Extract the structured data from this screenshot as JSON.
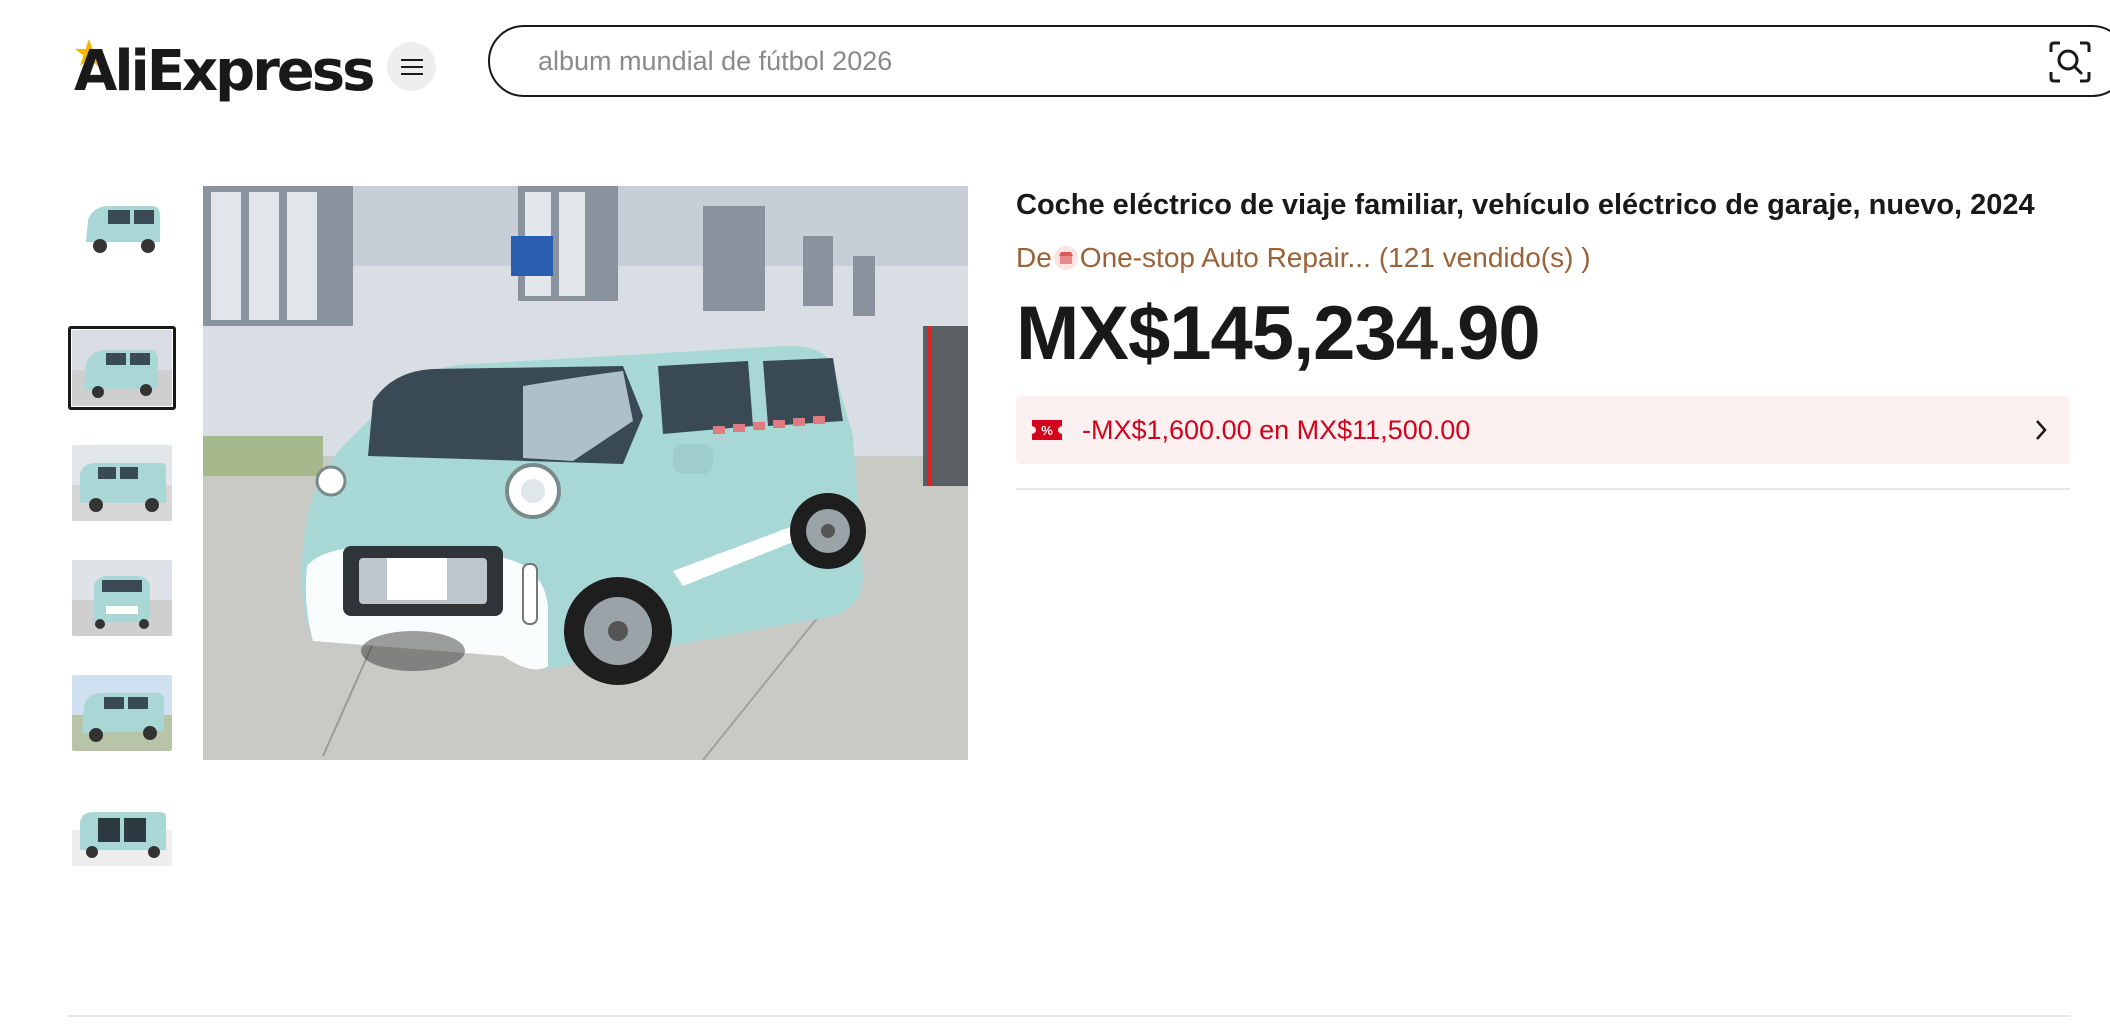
{
  "header": {
    "logo_text": "AliExpress",
    "search": {
      "placeholder": "album mundial de fútbol 2026",
      "value": ""
    },
    "menu_icon": "hamburger-menu-icon",
    "camera_icon": "image-search-icon"
  },
  "gallery": {
    "thumbnails": [
      {
        "label": "van-front-three-quarter",
        "active": false
      },
      {
        "label": "van-front-three-quarter-factory",
        "active": true
      },
      {
        "label": "van-side-view",
        "active": false
      },
      {
        "label": "van-front-view",
        "active": false
      },
      {
        "label": "van-front-side-outdoor",
        "active": false
      },
      {
        "label": "van-doors-open",
        "active": false
      }
    ]
  },
  "product": {
    "title": "Coche eléctrico de viaje familiar, vehículo eléctrico de garaje, nuevo, 2024",
    "store_prefix": "De",
    "store_name": "One-stop Auto Repair...",
    "sold_text": "(121 vendido(s) )",
    "price": "MX$145,234.90",
    "coupon_text": "-MX$1,600.00 en MX$11,500.00",
    "coupon_icon": "percent-coupon-icon"
  },
  "colors": {
    "coupon_red": "#d3031c",
    "coupon_bg": "#fdf0f1",
    "store_brown": "#9b6137",
    "text": "#191919",
    "van_body": "#a8d8d6"
  }
}
